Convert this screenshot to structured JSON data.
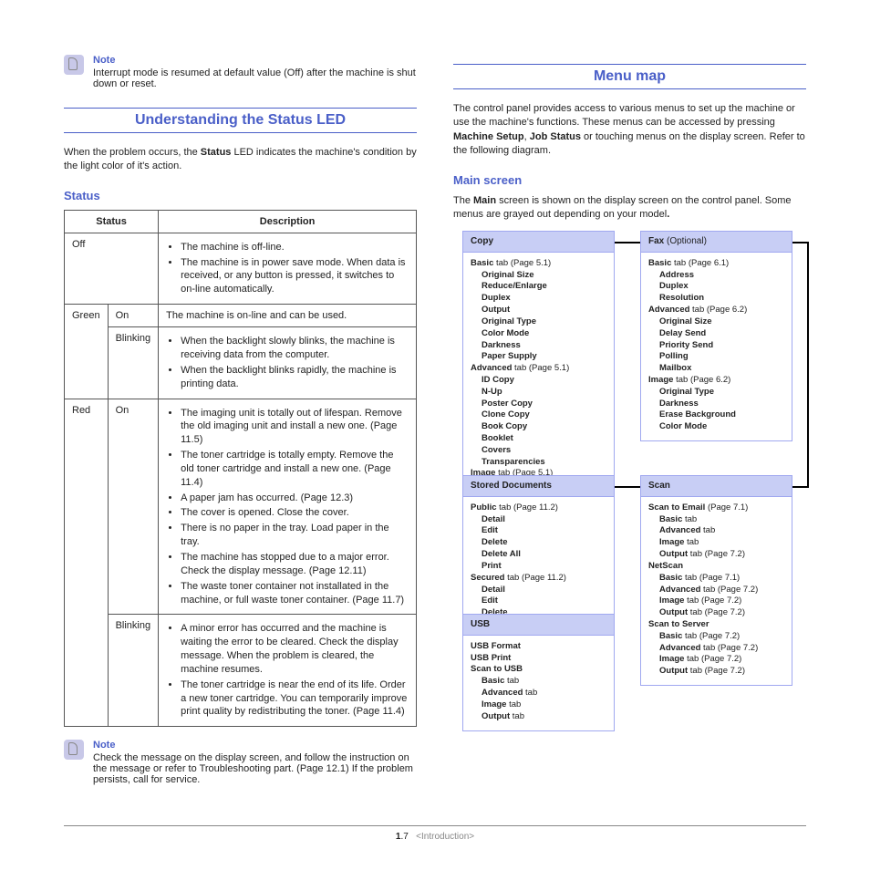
{
  "note_top": {
    "title": "Note",
    "text": "Interrupt mode is resumed at default value (Off) after the machine is shut down or reset."
  },
  "sec_led": {
    "title": "Understanding the Status LED",
    "intro_pre": "When the problem occurs, the ",
    "intro_bold": "Status",
    "intro_post": " LED indicates the machine's condition by the light color of it's action.",
    "sub": "Status",
    "th1": "Status",
    "th2": "Description",
    "row_off": {
      "label": "Off",
      "b1": "The machine is off-line.",
      "b2": "The machine is in power save mode. When data is received, or any button is pressed, it switches to on-line automatically."
    },
    "row_green": {
      "label": "Green",
      "on": "On",
      "on_text": "The machine is on-line and can be used.",
      "blink": "Blinking",
      "blink_b1": "When the backlight slowly blinks, the machine is receiving data from the computer.",
      "blink_b2": "When the backlight blinks rapidly, the machine is printing data."
    },
    "row_red": {
      "label": "Red",
      "on": "On",
      "on_b1": "The imaging unit is totally out of lifespan. Remove the old imaging unit and install a new one. (Page 11.5)",
      "on_b2": "The toner cartridge is totally empty. Remove the old toner cartridge and install a new one. (Page 11.4)",
      "on_b3": "A paper jam has occurred. (Page 12.3)",
      "on_b4": "The cover is opened. Close the cover.",
      "on_b5": "There is no paper in the tray. Load paper in the tray.",
      "on_b6": "The machine has stopped due to a major error. Check the display message. (Page 12.11)",
      "on_b7": "The waste toner container not installated in the machine, or full waste toner container. (Page 11.7)",
      "blink": "Blinking",
      "blink_b1": "A minor error has occurred and the machine is waiting the error to be cleared. Check the display message. When the problem is cleared, the machine resumes.",
      "blink_b2": "The toner cartridge is near the end of its life. Order a new toner cartridge. You can temporarily improve print quality by redistributing the toner. (Page 11.4)"
    }
  },
  "note_bottom": {
    "title": "Note",
    "text": "Check the message on the display screen, and follow the instruction on the message or refer to Troubleshooting part. (Page 12.1) If the problem persists, call for service."
  },
  "sec_menu": {
    "title": "Menu map",
    "intro_1": "The control panel provides access to various menus to set up the machine or use the machine's functions. These menus can be accessed by pressing ",
    "intro_b1": "Machine Setup",
    "intro_2": ", ",
    "intro_b2": "Job Status",
    "intro_3": " or touching menus on the display screen. Refer to the following diagram.",
    "sub": "Main screen",
    "main_intro_1": "The ",
    "main_intro_b": "Main",
    "main_intro_2": " screen is shown on the display screen on the control panel. Some menus are grayed out depending on your model",
    "main_intro_dot": "."
  },
  "boxes": {
    "copy_title": "Copy",
    "fax_title_b": "Fax",
    "fax_title_rest": " (Optional)",
    "stored_title": "Stored Documents",
    "scan_title": "Scan",
    "usb_title": "USB"
  },
  "footer": {
    "page_b": "1",
    "page_rest": ".7",
    "section": "<Introduction>"
  }
}
